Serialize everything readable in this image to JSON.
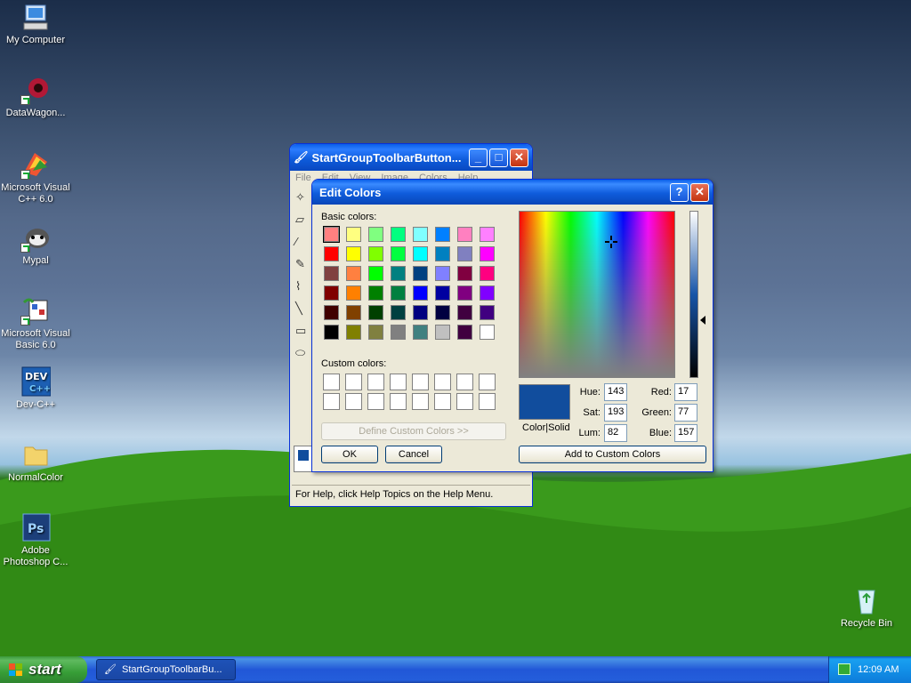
{
  "desktop_icons": [
    {
      "label": "My Computer",
      "icon": "computer-icon"
    },
    {
      "label": "DataWagon...",
      "icon": "datawagon-icon"
    },
    {
      "label": "Microsoft Visual C++ 6.0",
      "icon": "visual-cpp-icon"
    },
    {
      "label": "Mypal",
      "icon": "mypal-icon"
    },
    {
      "label": "Microsoft Visual Basic 6.0",
      "icon": "visual-basic-icon"
    },
    {
      "label": "Dev-C++",
      "icon": "devcpp-icon"
    },
    {
      "label": "NormalColor",
      "icon": "folder-icon"
    },
    {
      "label": "Adobe Photoshop C...",
      "icon": "photoshop-icon"
    },
    {
      "label": "Recycle Bin",
      "icon": "recycle-bin-icon"
    }
  ],
  "paint": {
    "title": "StartGroupToolbarButton...",
    "menu": [
      "File",
      "Edit",
      "View",
      "Image",
      "Colors",
      "Help"
    ],
    "status": "For Help, click Help Topics on the Help Menu."
  },
  "dialog": {
    "title": "Edit Colors",
    "basic_label": "Basic colors:",
    "custom_label": "Custom colors:",
    "define_button": "Define Custom Colors >>",
    "ok": "OK",
    "cancel": "Cancel",
    "add_button": "Add to Custom Colors",
    "colorsolid": "Color|Solid",
    "hue_label": "Hue:",
    "hue": "143",
    "sat_label": "Sat:",
    "sat": "193",
    "lum_label": "Lum:",
    "lum": "82",
    "red_label": "Red:",
    "red": "17",
    "green_label": "Green:",
    "green": "77",
    "blue_label": "Blue:",
    "blue": "157",
    "current_color": "#114d9d",
    "basic_colors": [
      "#ff8080",
      "#ffff80",
      "#80ff80",
      "#00ff80",
      "#80ffff",
      "#0080ff",
      "#ff80c0",
      "#ff80ff",
      "#ff0000",
      "#ffff00",
      "#80ff00",
      "#00ff40",
      "#00ffff",
      "#0080c0",
      "#8080c0",
      "#ff00ff",
      "#804040",
      "#ff8040",
      "#00ff00",
      "#008080",
      "#004080",
      "#8080ff",
      "#800040",
      "#ff0080",
      "#800000",
      "#ff8000",
      "#008000",
      "#008040",
      "#0000ff",
      "#0000a0",
      "#800080",
      "#8000ff",
      "#400000",
      "#804000",
      "#004000",
      "#004040",
      "#000080",
      "#000040",
      "#400040",
      "#400080",
      "#000000",
      "#808000",
      "#808040",
      "#808080",
      "#408080",
      "#c0c0c0",
      "#400040",
      "#ffffff"
    ]
  },
  "taskbar": {
    "start": "start",
    "task": "StartGroupToolbarBu...",
    "clock": "12:09 AM"
  }
}
